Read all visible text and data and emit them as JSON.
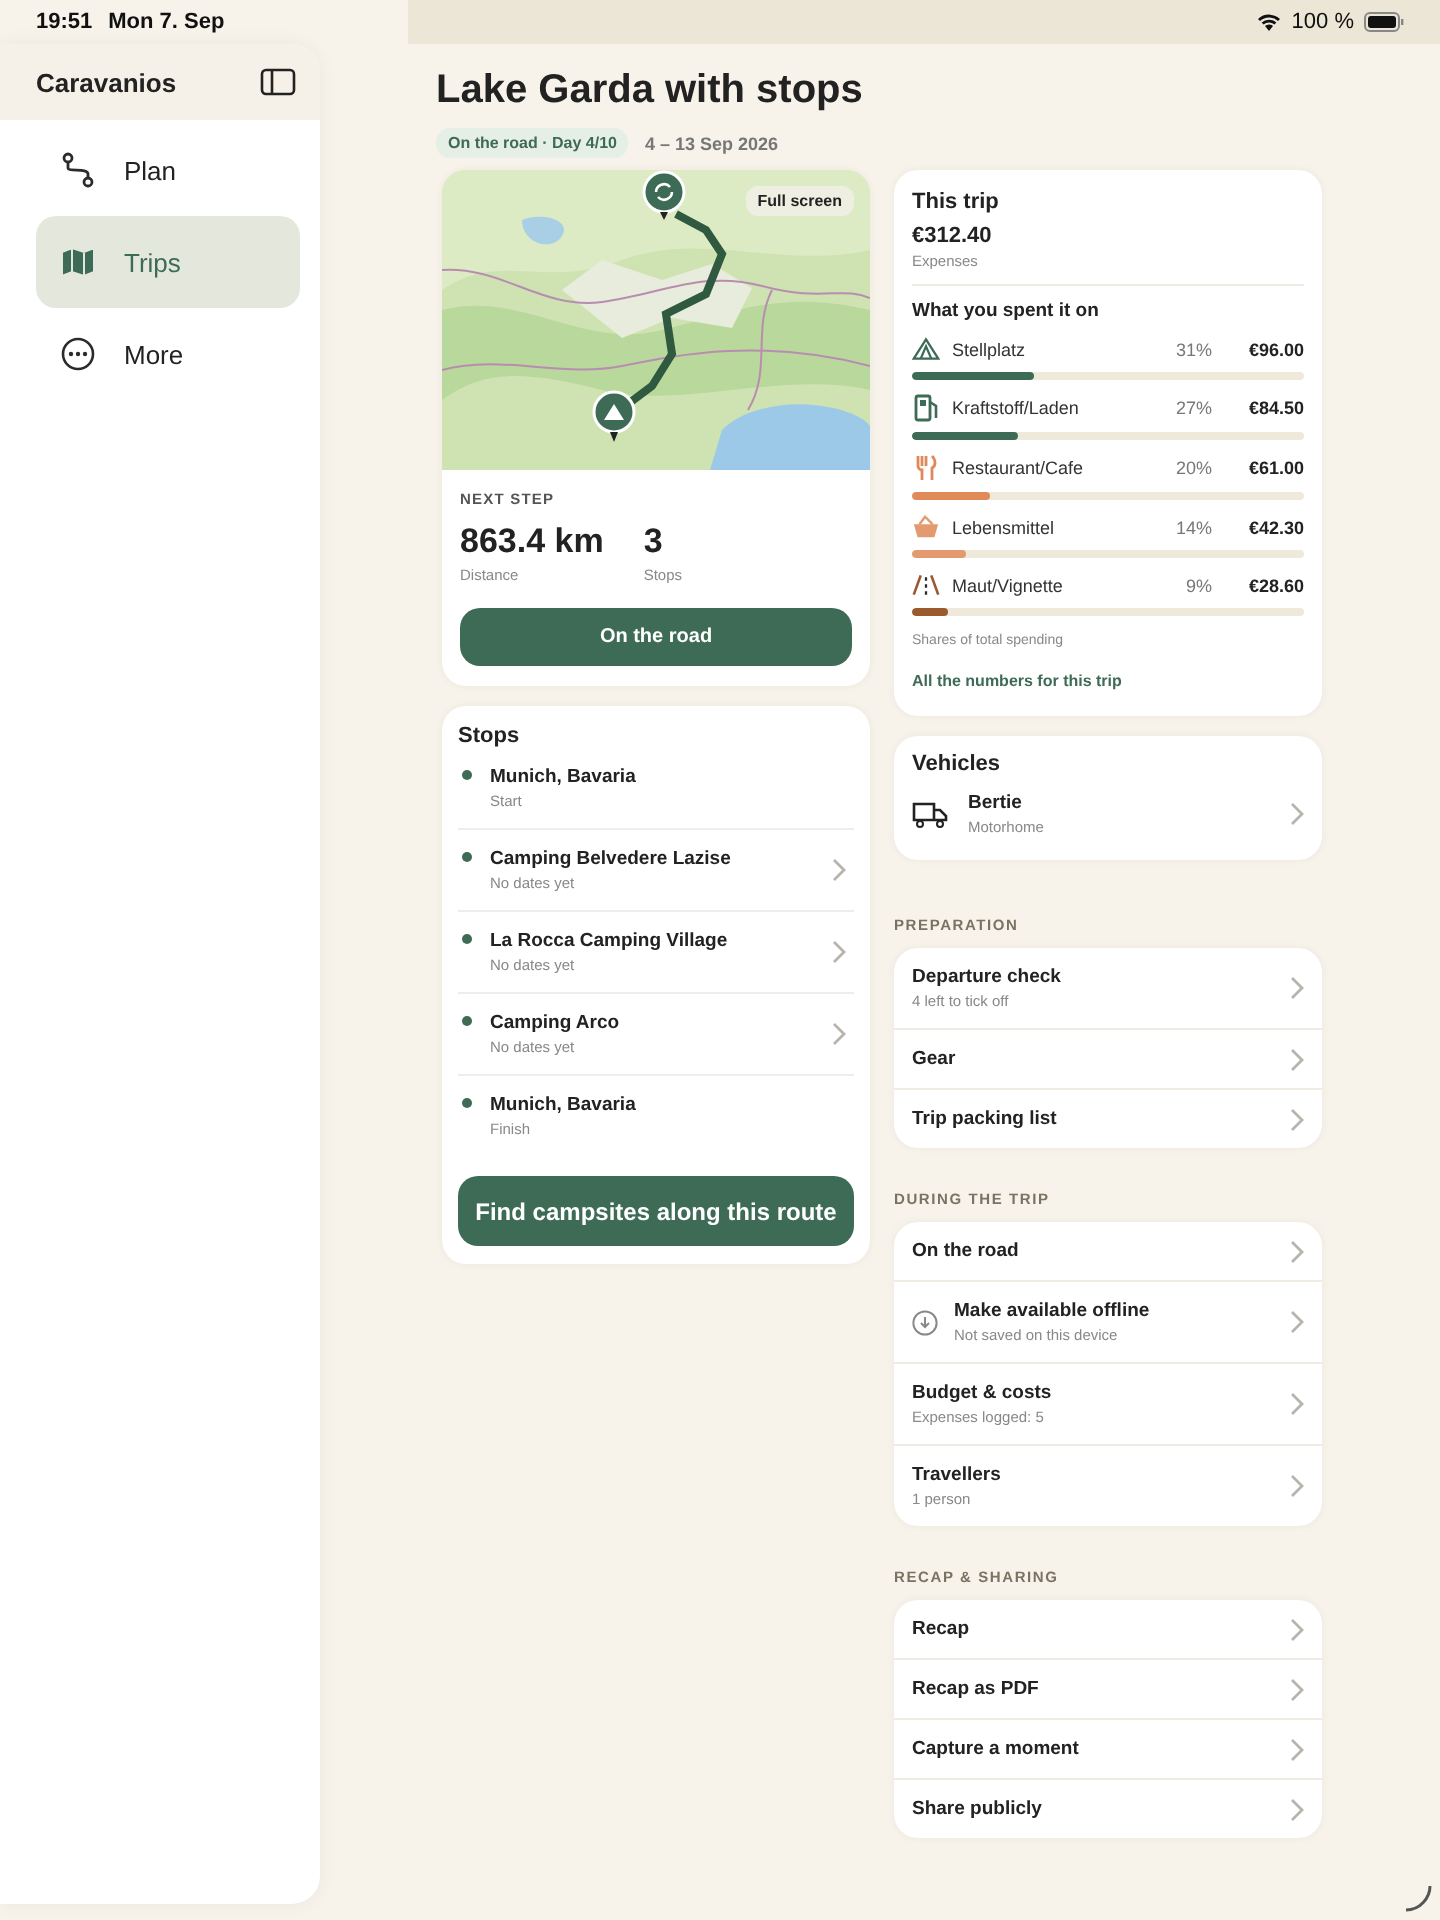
{
  "status_bar": {
    "time": "19:51",
    "date": "Mon 7. Sep",
    "battery": "100 %"
  },
  "sidebar": {
    "title": "Caravanios",
    "items": [
      {
        "label": "Plan",
        "kind": "route",
        "selected": false
      },
      {
        "label": "Trips",
        "kind": "map",
        "selected": true
      },
      {
        "label": "More",
        "kind": "more",
        "selected": false
      }
    ]
  },
  "trip": {
    "title": "Lake Garda with stops",
    "status": "On the road · Day 4/10",
    "dates": "4 – 13 Sep 2026"
  },
  "map": {
    "kind": "picture",
    "full_screen": "Full screen"
  },
  "next_step": {
    "label": "NEXT STEP",
    "distance": "863.4 km",
    "distance_label": "Distance",
    "stops": "3",
    "stops_label": "Stops",
    "button": "On the road"
  },
  "stops": {
    "title": "Stops",
    "items": [
      {
        "name": "Munich, Bavaria",
        "note": "Start",
        "navigable": false
      },
      {
        "name": "Camping Belvedere Lazise",
        "note": "No dates yet",
        "navigable": true
      },
      {
        "name": "La Rocca Camping Village",
        "note": "No dates yet",
        "navigable": true
      },
      {
        "name": "Camping Arco",
        "note": "No dates yet",
        "navigable": true
      },
      {
        "name": "Munich, Bavaria",
        "note": "Finish",
        "navigable": false
      }
    ],
    "button": "Find campsites along this route"
  },
  "budget": {
    "title": "This trip",
    "total": "€312.40",
    "total_label": "Expenses",
    "breakdown_title": "What you spent it on",
    "categories": [
      {
        "kind": "pitch",
        "name": "Stellplatz",
        "share": "31%",
        "amount": "€96.00",
        "level": 0.31,
        "color": "#3d6b56"
      },
      {
        "kind": "fuel",
        "name": "Kraftstoff/Laden",
        "share": "27%",
        "amount": "€84.50",
        "level": 0.27,
        "color": "#3d6b56"
      },
      {
        "kind": "food",
        "name": "Restaurant/Cafe",
        "share": "20%",
        "amount": "€61.00",
        "level": 0.2,
        "color": "#e08a5a"
      },
      {
        "kind": "basket",
        "name": "Lebensmittel",
        "share": "14%",
        "amount": "€42.30",
        "level": 0.14,
        "color": "#e39a6e"
      },
      {
        "kind": "toll",
        "name": "Maut/Vignette",
        "share": "9%",
        "amount": "€28.60",
        "level": 0.09,
        "color": "#9a5a2e"
      }
    ],
    "footnote": "Shares of total spending",
    "link": "All the numbers for this trip"
  },
  "vehicles": {
    "title": "Vehicles",
    "items": [
      {
        "name": "Bertie",
        "type": "Motorhome"
      }
    ]
  },
  "sections": [
    {
      "heading": "PREPARATION",
      "rows": [
        {
          "kind": "plain",
          "title": "Departure check",
          "subtitle": "4 left to tick off"
        },
        {
          "kind": "plain",
          "title": "Gear"
        },
        {
          "kind": "plain",
          "title": "Trip packing list"
        }
      ]
    },
    {
      "heading": "DURING THE TRIP",
      "rows": [
        {
          "kind": "plain",
          "title": "On the road"
        },
        {
          "kind": "download",
          "title": "Make available offline",
          "subtitle": "Not saved on this device"
        },
        {
          "kind": "plain",
          "title": "Budget & costs",
          "subtitle": "Expenses logged: 5"
        },
        {
          "kind": "plain",
          "title": "Travellers",
          "subtitle": "1 person"
        }
      ]
    },
    {
      "heading": "RECAP & SHARING",
      "rows": [
        {
          "kind": "plain",
          "title": "Recap"
        },
        {
          "kind": "plain",
          "title": "Recap as PDF"
        },
        {
          "kind": "plain",
          "title": "Capture a moment"
        },
        {
          "kind": "plain",
          "title": "Share publicly"
        }
      ]
    }
  ]
}
